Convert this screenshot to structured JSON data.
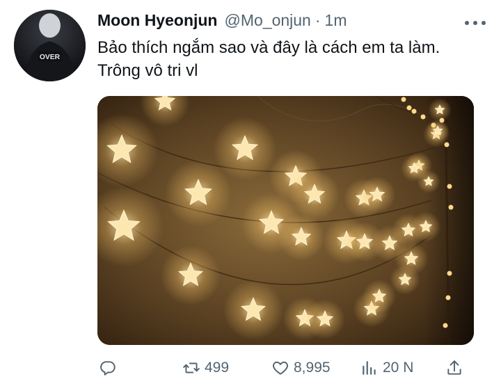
{
  "tweet": {
    "author": {
      "display_name": "Moon Hyeonjun",
      "handle": "@Mo_onjun",
      "separator": "·",
      "time": "1m",
      "avatar_text": "OVER"
    },
    "text": "Bảo thích ngắm sao và đây là cách em ta làm. Trông vô tri vl",
    "media": {
      "alt": "star string lights photo"
    },
    "actions": {
      "reply": {
        "icon": "reply-icon",
        "count": ""
      },
      "retweet": {
        "icon": "retweet-icon",
        "count": "499"
      },
      "like": {
        "icon": "heart-icon",
        "count": "8,995"
      },
      "views": {
        "icon": "views-icon",
        "count": "20 N"
      },
      "share": {
        "icon": "share-icon",
        "count": ""
      }
    }
  },
  "colors": {
    "text_primary": "#0f1419",
    "text_secondary": "#536471",
    "background": "#ffffff",
    "photo_glow": "#f5c46a"
  }
}
